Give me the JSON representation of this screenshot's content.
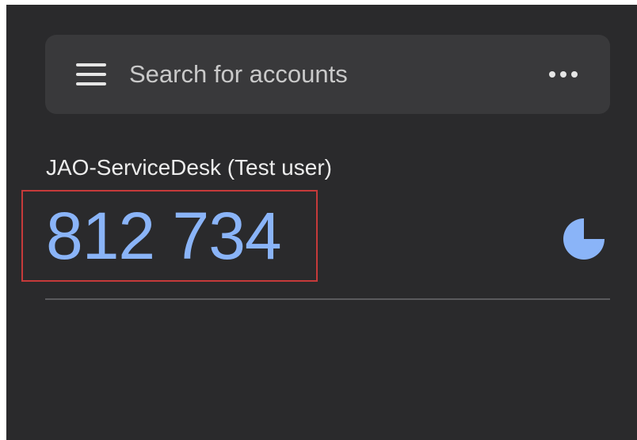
{
  "search": {
    "placeholder": "Search for accounts",
    "menu_icon": "hamburger-menu-icon",
    "more_icon": "more-horizontal-icon"
  },
  "account": {
    "name": "JAO-ServiceDesk (Test user)",
    "code": "812 734",
    "timer_icon": "countdown-pie-icon",
    "timer_remaining_fraction": 0.75
  },
  "colors": {
    "background": "#2a2a2c",
    "search_bar": "#39393b",
    "code": "#8ab4f8",
    "highlight_box": "#c63a3a"
  }
}
